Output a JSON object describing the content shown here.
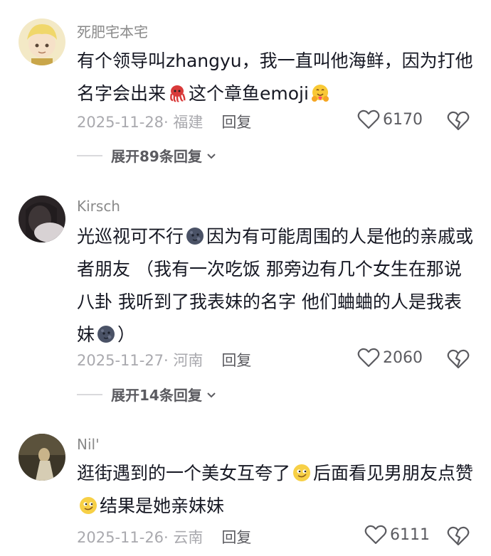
{
  "comments": [
    {
      "username": "死肥宅本宅",
      "text_parts": [
        "有个领导叫zhangyu，我一直叫他海鲜，因为打他名字会出来",
        "这个章鱼emoji"
      ],
      "emoji_icons": [
        "octopus-emoji",
        "hugging-face-emoji"
      ],
      "date": "2025-11-28",
      "region": "· 福建",
      "reply_label": "回复",
      "likes": "6170",
      "expand_label": "展开89条回复"
    },
    {
      "username": "Kirsch",
      "text_parts": [
        "光巡视可不行",
        "因为有可能周围的人是他的亲戚或者朋友 （我有一次吃饭 那旁边有几个女生在那说八卦 我听到了我表妹的名字 他们蛐蛐的人是我表妹",
        "）"
      ],
      "emoji_icons": [
        "dark-moon-face-emoji",
        "dark-moon-face-emoji"
      ],
      "date": "2025-11-27",
      "region": "· 河南",
      "reply_label": "回复",
      "likes": "2060",
      "expand_label": "展开14条回复"
    },
    {
      "username": "Nil'",
      "text_parts": [
        "逛街遇到的一个美女互夸了",
        "后面看见男朋友点赞",
        "结果是她亲妹妹"
      ],
      "emoji_icons": [
        "smirk-face-emoji",
        "smirk-face-emoji"
      ],
      "date": "2025-11-26",
      "region": "· 云南",
      "reply_label": "回复",
      "likes": "6111"
    }
  ],
  "colors": {
    "text": "#161823",
    "meta": "#a9a9ae",
    "action": "#5b5b60"
  }
}
